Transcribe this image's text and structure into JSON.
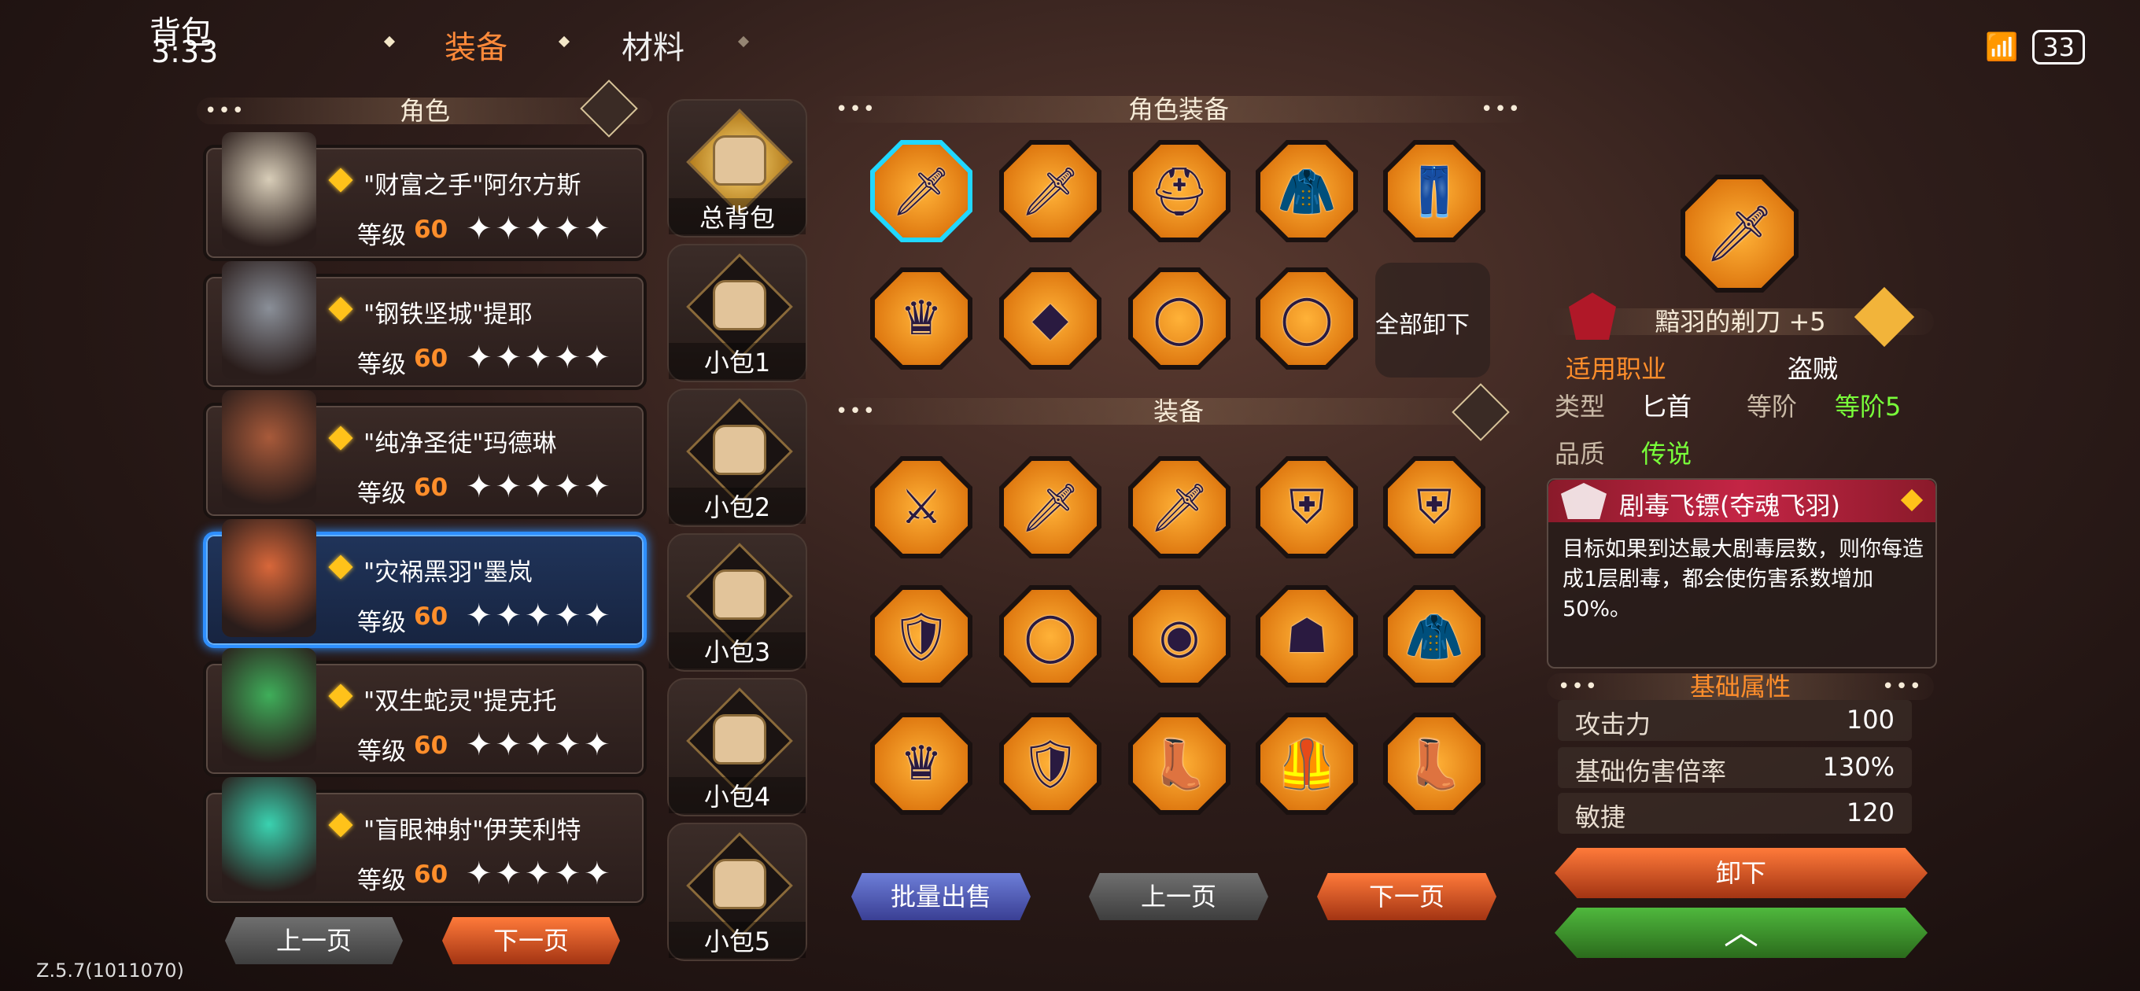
{
  "status_bar": {
    "title_overlay": "背包",
    "time": "3:33",
    "battery": "33"
  },
  "tabs": [
    {
      "label": "装备",
      "active": true
    },
    {
      "label": "材料",
      "active": false
    }
  ],
  "left_panel": {
    "header": "角色",
    "characters": [
      {
        "name": "\"财富之手\"阿尔方斯",
        "level_label": "等级",
        "level": "60",
        "stars": "✦✦✦✦✦",
        "selected": false,
        "portrait_color": "#d8cdb8"
      },
      {
        "name": "\"钢铁坚城\"提耶",
        "level_label": "等级",
        "level": "60",
        "stars": "✦✦✦✦✦",
        "selected": false,
        "portrait_color": "#8a8f98"
      },
      {
        "name": "\"纯净圣徒\"玛德琳",
        "level_label": "等级",
        "level": "60",
        "stars": "✦✦✦✦✦",
        "selected": false,
        "portrait_color": "#a85a3a"
      },
      {
        "name": "\"灾祸黑羽\"墨岚",
        "level_label": "等级",
        "level": "60",
        "stars": "✦✦✦✦✦",
        "selected": true,
        "portrait_color": "#d8673a"
      },
      {
        "name": "\"双生蛇灵\"提克托",
        "level_label": "等级",
        "level": "60",
        "stars": "✦✦✦✦✦",
        "selected": false,
        "portrait_color": "#3fae5a"
      },
      {
        "name": "\"盲眼神射\"伊芙利特",
        "level_label": "等级",
        "level": "60",
        "stars": "✦✦✦✦✦",
        "selected": false,
        "portrait_color": "#3ad2b0"
      }
    ],
    "prev_page": "上一页",
    "next_page": "下一页"
  },
  "bags": [
    {
      "label": "总背包",
      "main": true
    },
    {
      "label": "小包1"
    },
    {
      "label": "小包2"
    },
    {
      "label": "小包3"
    },
    {
      "label": "小包4"
    },
    {
      "label": "小包5"
    }
  ],
  "character_equipment": {
    "header": "角色装备",
    "slots": [
      {
        "icon": "dagger-icon",
        "glyph": "🗡",
        "selected": true
      },
      {
        "icon": "dagger-icon",
        "glyph": "🗡"
      },
      {
        "icon": "helmet-icon",
        "glyph": "⛑"
      },
      {
        "icon": "armor-icon",
        "glyph": "🧥"
      },
      {
        "icon": "pants-icon",
        "glyph": "👖"
      },
      {
        "icon": "headband-icon",
        "glyph": "♛"
      },
      {
        "icon": "necklace-icon",
        "glyph": "◆"
      },
      {
        "icon": "ring-icon",
        "glyph": "◯"
      },
      {
        "icon": "ring-icon",
        "glyph": "◯"
      }
    ],
    "unequip_all": "全部卸下"
  },
  "inventory": {
    "header": "装备",
    "items": [
      {
        "icon": "scimitar-icon",
        "glyph": "⚔"
      },
      {
        "icon": "dagger-icon",
        "glyph": "🗡"
      },
      {
        "icon": "red-dagger-icon",
        "glyph": "🗡"
      },
      {
        "icon": "helm-icon",
        "glyph": "⛨"
      },
      {
        "icon": "helm-icon",
        "glyph": "⛨"
      },
      {
        "icon": "gold-armor-icon",
        "glyph": "🛡"
      },
      {
        "icon": "ring-icon",
        "glyph": "◯"
      },
      {
        "icon": "gem-ring-icon",
        "glyph": "◉"
      },
      {
        "icon": "hood-icon",
        "glyph": "☗"
      },
      {
        "icon": "cloak-icon",
        "glyph": "🧥"
      },
      {
        "icon": "winged-headband-icon",
        "glyph": "♛"
      },
      {
        "icon": "blue-armor-icon",
        "glyph": "🛡"
      },
      {
        "icon": "boots-icon",
        "glyph": "👢"
      },
      {
        "icon": "vest-icon",
        "glyph": "🦺"
      },
      {
        "icon": "purple-boots-icon",
        "glyph": "👢"
      }
    ],
    "bulk_sell": "批量出售",
    "prev_page": "上一页",
    "next_page": "下一页"
  },
  "detail": {
    "item_name": "黯羽的剃刀 +5",
    "class_label": "适用职业",
    "class_value": "盗贼",
    "type_label": "类型",
    "type_value": "匕首",
    "tier_label": "等阶",
    "tier_value": "等阶5",
    "quality_label": "品质",
    "quality_value": "传说",
    "skill_name": "剧毒飞镖(夺魂飞羽)",
    "skill_desc": "目标如果到达最大剧毒层数，则你每造成1层剧毒，都会使伤害系数增加50%。",
    "attributes_header": "基础属性",
    "attributes": [
      {
        "name": "攻击力",
        "value": "100"
      },
      {
        "name": "基础伤害倍率",
        "value": "130%"
      },
      {
        "name": "敏捷",
        "value": "120"
      }
    ],
    "unequip_btn": "卸下"
  },
  "version": "Z.5.7(1011070)"
}
